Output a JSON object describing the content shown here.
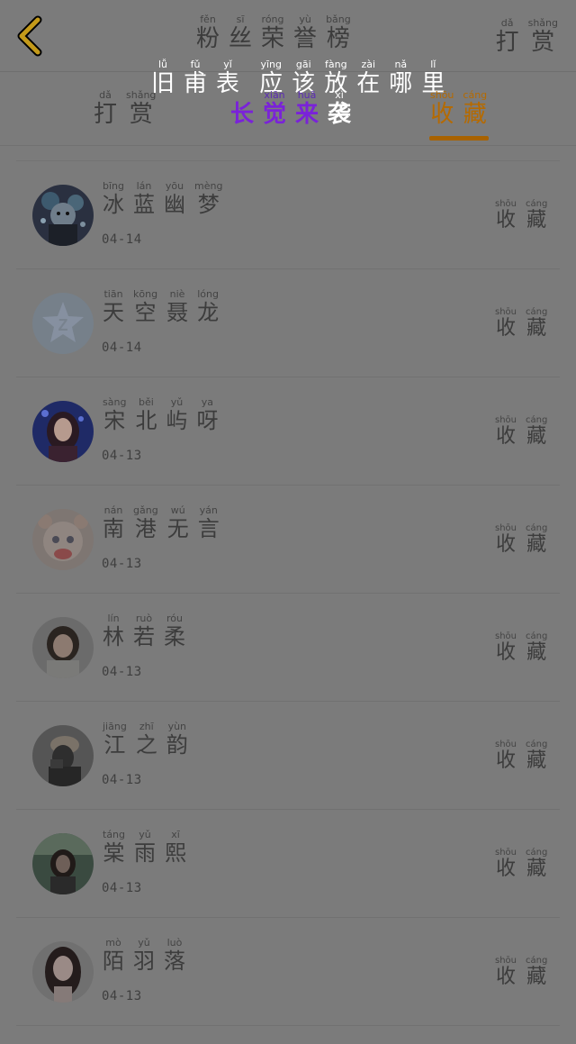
{
  "header": {
    "back_icon": "chevron-left-icon",
    "back_color": "#c49a1a",
    "title": [
      {
        "py": "fěn",
        "hz": "粉"
      },
      {
        "py": "sī",
        "hz": "丝"
      },
      {
        "py": "róng",
        "hz": "荣"
      },
      {
        "py": "yù",
        "hz": "誉"
      },
      {
        "py": "bǎng",
        "hz": "榜"
      }
    ],
    "reward": [
      {
        "py": "dǎ",
        "hz": "打"
      },
      {
        "py": "shǎng",
        "hz": "赏"
      }
    ]
  },
  "overlay_caption": {
    "group1": [
      {
        "py": "lǚ",
        "hz": "旧"
      },
      {
        "py": "fǔ",
        "hz": "甫"
      },
      {
        "py": "yǐ",
        "hz": "表"
      }
    ],
    "group2": [
      {
        "py": "yīng",
        "hz": "应"
      },
      {
        "py": "gāi",
        "hz": "该"
      },
      {
        "py": "fàng",
        "hz": "放"
      },
      {
        "py": "zài",
        "hz": "在"
      },
      {
        "py": "nǎ",
        "hz": "哪"
      },
      {
        "py": "lǐ",
        "hz": "里"
      }
    ]
  },
  "tabs": {
    "reward": [
      {
        "py": "dǎ",
        "hz": "打"
      },
      {
        "py": "shǎng",
        "hz": "赏"
      }
    ],
    "hero": [
      {
        "py": "",
        "hz": "长"
      },
      {
        "py": "xiān",
        "hz": "觉"
      },
      {
        "py": "huā",
        "hz": "来"
      },
      {
        "py": "xì",
        "hz": "袭"
      }
    ],
    "favorite": [
      {
        "py": "shōu",
        "hz": "收"
      },
      {
        "py": "cáng",
        "hz": "藏"
      }
    ],
    "active_color": "#b56a00"
  },
  "fav_label": [
    {
      "py": "shōu",
      "hz": "收"
    },
    {
      "py": "cáng",
      "hz": "藏"
    }
  ],
  "fans": [
    {
      "name": [
        {
          "py": "bīng",
          "hz": "冰"
        },
        {
          "py": "lán",
          "hz": "蓝"
        },
        {
          "py": "yōu",
          "hz": "幽"
        },
        {
          "py": "mèng",
          "hz": "梦"
        }
      ],
      "date": "04-14",
      "avatar": "anime-avatar-dark"
    },
    {
      "name": [
        {
          "py": "tiān",
          "hz": "天"
        },
        {
          "py": "kōng",
          "hz": "空"
        },
        {
          "py": "niè",
          "hz": "聂"
        },
        {
          "py": "lóng",
          "hz": "龙"
        }
      ],
      "date": "04-14",
      "avatar": "qzone-default-avatar"
    },
    {
      "name": [
        {
          "py": "sàng",
          "hz": "宋"
        },
        {
          "py": "běi",
          "hz": "北"
        },
        {
          "py": "yǔ",
          "hz": "屿"
        },
        {
          "py": "ya",
          "hz": "呀"
        }
      ],
      "date": "04-13",
      "avatar": "girl-stage-avatar"
    },
    {
      "name": [
        {
          "py": "nán",
          "hz": "南"
        },
        {
          "py": "gǎng",
          "hz": "港"
        },
        {
          "py": "wú",
          "hz": "无"
        },
        {
          "py": "yán",
          "hz": "言"
        }
      ],
      "date": "04-13",
      "avatar": "cartoon-bear-avatar"
    },
    {
      "name": [
        {
          "py": "lín",
          "hz": "林"
        },
        {
          "py": "ruò",
          "hz": "若"
        },
        {
          "py": "róu",
          "hz": "柔"
        }
      ],
      "date": "04-13",
      "avatar": "girl-portrait-avatar"
    },
    {
      "name": [
        {
          "py": "jiāng",
          "hz": "江"
        },
        {
          "py": "zhī",
          "hz": "之"
        },
        {
          "py": "yùn",
          "hz": "韵"
        }
      ],
      "date": "04-13",
      "avatar": "hat-girl-avatar"
    },
    {
      "name": [
        {
          "py": "táng",
          "hz": "棠"
        },
        {
          "py": "yǔ",
          "hz": "雨"
        },
        {
          "py": "xī",
          "hz": "熙"
        }
      ],
      "date": "04-13",
      "avatar": "outdoor-girl-avatar"
    },
    {
      "name": [
        {
          "py": "mò",
          "hz": "陌"
        },
        {
          "py": "yǔ",
          "hz": "羽"
        },
        {
          "py": "luò",
          "hz": "落"
        }
      ],
      "date": "04-13",
      "avatar": "long-hair-girl-avatar"
    }
  ]
}
